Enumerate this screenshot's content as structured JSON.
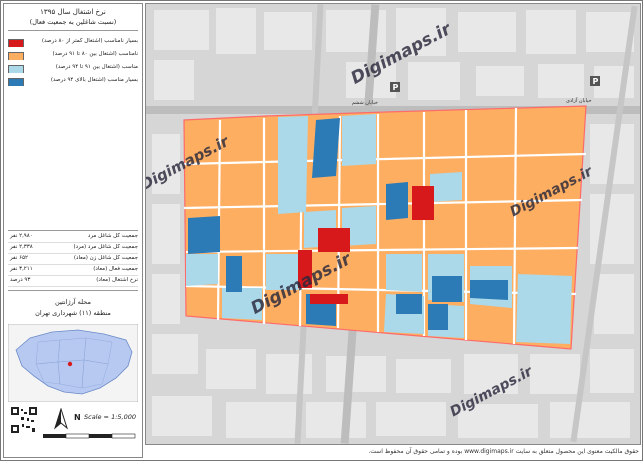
{
  "title": {
    "line1": "نرخ اشتغال سال ۱۳۹۵",
    "line2": "(نسبت شاغلین به جمعیت فعال)"
  },
  "legend": [
    {
      "label": "بسیار نامناسب (اشتغال کمتر از ۸۰ درصد)",
      "color": "#d7191c"
    },
    {
      "label": "نامناسب (اشتغال بین ۸۰ تا ۹۱ درصد)",
      "color": "#fdae61"
    },
    {
      "label": "مناسب (اشتغال بین ۹۱ تا ۹۴ درصد)",
      "color": "#abd9e9"
    },
    {
      "label": "بسیار مناسب (اشتغال بالای ۹۴ درصد)",
      "color": "#2c7bb6"
    }
  ],
  "stats": [
    {
      "label": "جمعیت کل شاغل مرد",
      "value": "۲,۹۸۰ نفر"
    },
    {
      "label": "جمعیت کل شاغل مرد (مرد)",
      "value": "۲,۳۳۸ نفر"
    },
    {
      "label": "جمعیت کل شاغل زن (معاد)",
      "value": "۶۵۲ نفر"
    },
    {
      "label": "جمعیت فعال (معاد)",
      "value": "۳,۲۱۱ نفر"
    },
    {
      "label": "نرخ اشتغال (معاد)",
      "value": "۹۳ درصد"
    }
  ],
  "location": {
    "line1": "محله آرژانتین",
    "line2": "منطقه (۱۱) شهرداری تهران"
  },
  "scale_text": "Scale = 1:5,000",
  "north_letter": "N",
  "watermark": "Digimaps.ir",
  "map_labels": {
    "street_top": "خیابان ششم",
    "street_right": "خیابان آزادی"
  },
  "footer": "حقوق مالکیت معنوی این محصول متعلق به سایت www.digimaps.ir بوده و تمامی حقوق آن محفوظ است."
}
